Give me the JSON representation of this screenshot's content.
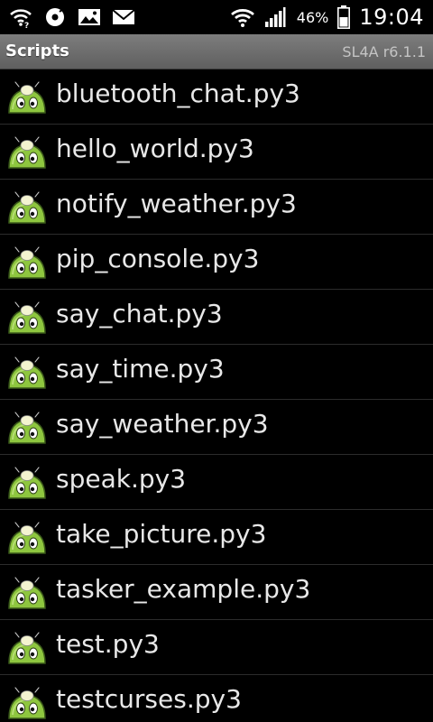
{
  "status_bar": {
    "left_icons": [
      "wifi-signal-icon",
      "sync-icon",
      "image-icon",
      "email-icon"
    ],
    "right_icons": [
      "wifi-icon",
      "cell-signal-icon",
      "battery-icon"
    ],
    "battery_percent": "46%",
    "time": "19:04"
  },
  "title_bar": {
    "title": "Scripts",
    "version": "SL4A r6.1.1"
  },
  "scripts": {
    "icon": "python-script-icon",
    "items": [
      {
        "label": "bluetooth_chat.py3"
      },
      {
        "label": "hello_world.py3"
      },
      {
        "label": "notify_weather.py3"
      },
      {
        "label": "pip_console.py3"
      },
      {
        "label": "say_chat.py3"
      },
      {
        "label": "say_time.py3"
      },
      {
        "label": "say_weather.py3"
      },
      {
        "label": "speak.py3"
      },
      {
        "label": "take_picture.py3"
      },
      {
        "label": "tasker_example.py3"
      },
      {
        "label": "test.py3"
      },
      {
        "label": "testcurses.py3"
      }
    ]
  },
  "colors": {
    "background": "#000000",
    "title_bar": "#6e6e6e",
    "text": "#e8e8e8",
    "icon_green": "#8ec63f"
  }
}
